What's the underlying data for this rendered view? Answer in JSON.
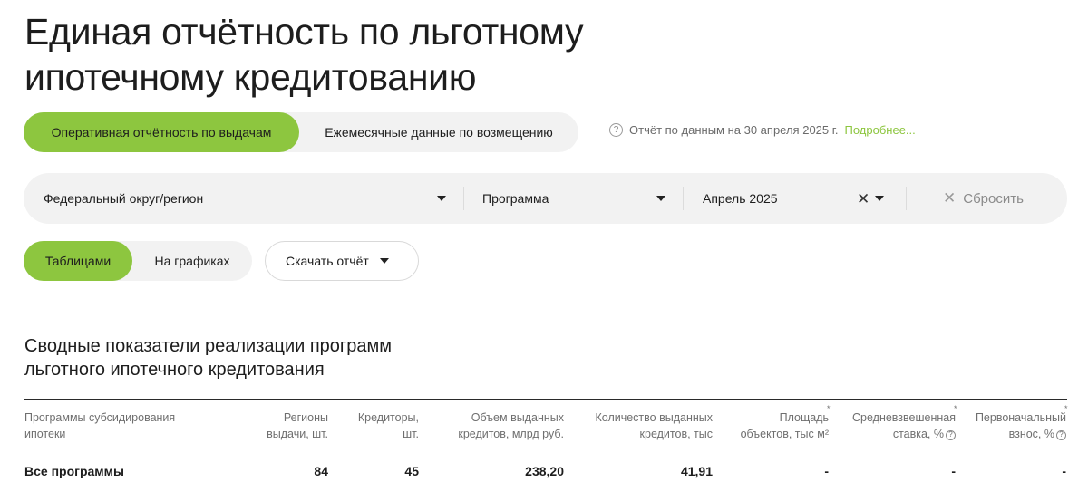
{
  "page": {
    "title_line1": "Единая отчётность по льготному",
    "title_line2": "ипотечному кредитованию"
  },
  "report_tabs": [
    {
      "label": "Оперативная отчётность по выдачам",
      "active": true
    },
    {
      "label": "Ежемесячные данные по возмещению",
      "active": false
    }
  ],
  "report_note": {
    "text": "Отчёт по данным на 30 апреля 2025 г.",
    "link": "Подробнее..."
  },
  "filters": {
    "region": "Федеральный округ/регион",
    "program": "Программа",
    "period": "Апрель 2025",
    "reset": "Сбросить"
  },
  "view_tabs": [
    {
      "label": "Таблицами",
      "active": true
    },
    {
      "label": "На графиках",
      "active": false
    }
  ],
  "download": {
    "label": "Скачать отчёт"
  },
  "section": {
    "title_line1": "Сводные показатели реализации программ",
    "title_line2": "льготного ипотечного кредитования"
  },
  "table": {
    "headers": [
      {
        "line1": "Программы субсидирования",
        "line2": "ипотеки"
      },
      {
        "line1": "Регионы",
        "line2": "выдачи, шт."
      },
      {
        "line1": "Кредиторы,",
        "line2": "шт."
      },
      {
        "line1": "Объем выданных",
        "line2": "кредитов, млрд руб."
      },
      {
        "line1": "Количество выданных",
        "line2": "кредитов, тыс"
      },
      {
        "line1": "Площадь",
        "line2": "объектов, тыс м²"
      },
      {
        "line1": "Средневзвешенная",
        "line2": "ставка, %"
      },
      {
        "line1": "Первоначальный",
        "line2": "взнос, %"
      }
    ],
    "rows": [
      {
        "program": "Все программы",
        "regions": "84",
        "creditors": "45",
        "volume": "238,20",
        "count": "41,91",
        "area": "-",
        "rate": "-",
        "down_payment": "-"
      }
    ]
  },
  "colors": {
    "accent": "#8dc63f",
    "pill_bg": "#f2f2f2",
    "link": "#8dc63f"
  }
}
